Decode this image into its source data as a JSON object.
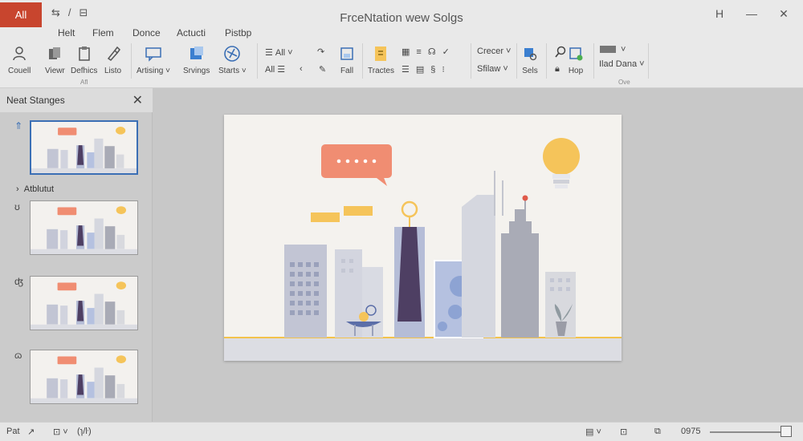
{
  "app_button": "All",
  "quick_access": [
    "⇆",
    "/",
    "⊟"
  ],
  "window_title": "FrceNtation wew Solgs",
  "window_controls": {
    "help": "H",
    "minimize": "—",
    "close": "✕"
  },
  "tabs": [
    "Helt",
    "Flem",
    "Donce",
    "Actucti",
    "Pistbp"
  ],
  "ribbon": {
    "big": [
      {
        "label": "Couell",
        "icon": "person-icon"
      },
      {
        "label": "Viewr",
        "icon": "copy-icon"
      },
      {
        "label": "Defhics",
        "icon": "clipboard-icon"
      },
      {
        "label": "Listo",
        "icon": "brush-icon"
      },
      {
        "label": "Artising ˅",
        "icon": "comment-icon"
      },
      {
        "label": "Srvings",
        "icon": "share-icon"
      },
      {
        "label": "Starts ˅",
        "icon": "globe-icon"
      },
      {
        "label": "Fall",
        "icon": "layout-icon"
      },
      {
        "label": "Tractes",
        "icon": "document-icon"
      },
      {
        "label": "Sels",
        "icon": "image-edit-icon"
      },
      {
        "label": "Hop",
        "icon": "picture-icon"
      }
    ],
    "small": {
      "all_top": "All",
      "all_bottom": "All",
      "dropdown_a": "Crecer",
      "dropdown_b": "Sfilaw",
      "dropdown_c": "Ilad Dana"
    },
    "groups": [
      "Afl",
      "Ove"
    ]
  },
  "pane": {
    "title": "Neat Stanges",
    "close": "✕",
    "section_label": "Atblutut",
    "slide_markers": [
      "⇑",
      "ʊ",
      "ʤ",
      "ɷ"
    ]
  },
  "status": {
    "left_label": "Pat",
    "left_mid": "(ɿ/ŀ)",
    "zoom": "0975"
  },
  "colors": {
    "accent": "#c8452e",
    "selection": "#3b6fb5",
    "speech_bubble": "#f08d72",
    "bulb": "#f5c45a",
    "tie": "#4e3f63",
    "building": "#c2c5d4",
    "ground_line": "#f3c24b"
  }
}
